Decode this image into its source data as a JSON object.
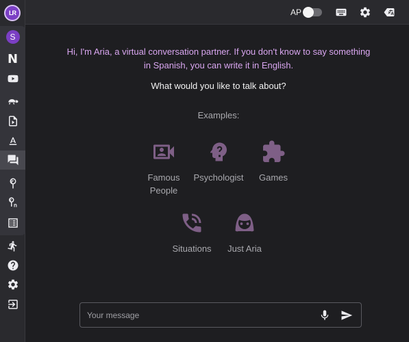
{
  "sidebar": {
    "logo_text": "LR",
    "avatar_letter": "S",
    "netflix_letter": "N",
    "items": [
      {
        "icon": "youtube-icon"
      },
      {
        "icon": "turtle-icon"
      },
      {
        "icon": "video-file-icon"
      },
      {
        "icon": "text-format-icon"
      },
      {
        "icon": "chat-icon",
        "active": true
      },
      {
        "icon": "lollipop-icon"
      },
      {
        "icon": "lollipop-n-icon"
      },
      {
        "icon": "list-icon"
      },
      {
        "icon": "accessibility-icon"
      },
      {
        "icon": "help-icon"
      },
      {
        "icon": "settings-icon"
      },
      {
        "icon": "login-icon"
      }
    ]
  },
  "topbar": {
    "ap_label": "AP",
    "ap_toggle_on": false
  },
  "chat": {
    "intro": "Hi, I'm Aria, a virtual conversation partner. If you don't know to say something in Spanish, you can write it in English.",
    "question": "What would you like to talk about?",
    "examples_label": "Examples:",
    "examples": [
      {
        "label": "Famous People",
        "icon": "contact-card-icon"
      },
      {
        "label": "Psychologist",
        "icon": "head-question-icon"
      },
      {
        "label": "Games",
        "icon": "puzzle-icon"
      },
      {
        "label": "Situations",
        "icon": "phone-call-icon"
      },
      {
        "label": "Just Aria",
        "icon": "face-icon"
      }
    ],
    "accent_color": "#d9a6f0",
    "icon_color": "#7e5f86"
  },
  "composer": {
    "placeholder": "Your message",
    "value": ""
  }
}
